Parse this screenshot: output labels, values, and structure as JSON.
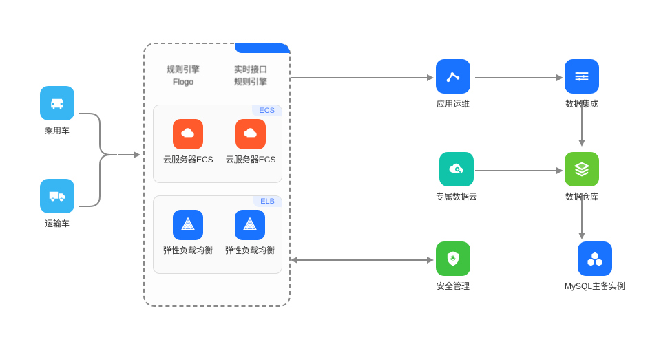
{
  "left": {
    "car": "乘用车",
    "truck": "运输车"
  },
  "panel": {
    "headers": [
      {
        "l1": "规则引擎",
        "l2": "Flogo"
      },
      {
        "l1": "实时接口",
        "l2": "规则引擎"
      }
    ],
    "ecs": {
      "chip": "ECS",
      "label": "云服务器ECS"
    },
    "elb": {
      "chip": "ELB",
      "label": "弹性负载均衡"
    }
  },
  "right": {
    "aom": "应用运维",
    "cdm": "数据集成",
    "cloud": "专属数据云",
    "security": "安全管理",
    "dws": "数据仓库",
    "mysql": "MySQL主备实例"
  },
  "colors": {
    "sky": "#38b6f4",
    "orange": "#ff5a2b",
    "blue": "#1a73ff",
    "teal": "#10c4a9",
    "greenA": "#3fc240",
    "greenB": "#66c933",
    "navy": "#1a73ff"
  }
}
